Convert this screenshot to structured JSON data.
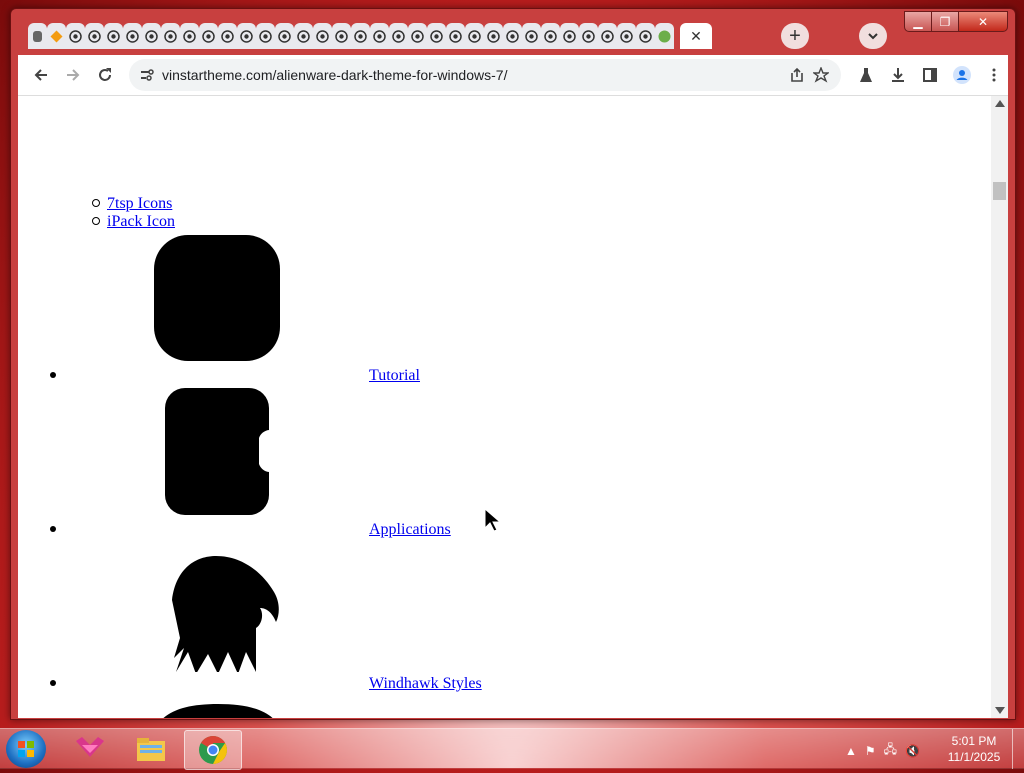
{
  "browser": {
    "url": "vinstartheme.com/alienware-dark-theme-for-windows-7/",
    "tab_count_visible": 34,
    "window_controls": {
      "minimize": "minimize-icon",
      "maximize": "maximize-icon",
      "close": "close-icon"
    }
  },
  "page": {
    "sublinks": [
      "7tsp Icons",
      "iPack Icon"
    ],
    "menu_items": [
      {
        "label": " Tutorial",
        "icon": "rounded-square-icon"
      },
      {
        "label": " Applications",
        "icon": "application-shape-icon"
      },
      {
        "label": " Windhawk Styles",
        "icon": "eagle-icon"
      }
    ]
  },
  "taskbar": {
    "clock_time": "5:01 PM",
    "clock_date": "11/1/2025",
    "apps": [
      "windows-start",
      "paint-app",
      "file-explorer",
      "chrome"
    ]
  },
  "colors": {
    "link": "#0000ee",
    "accent": "#c8403f"
  }
}
